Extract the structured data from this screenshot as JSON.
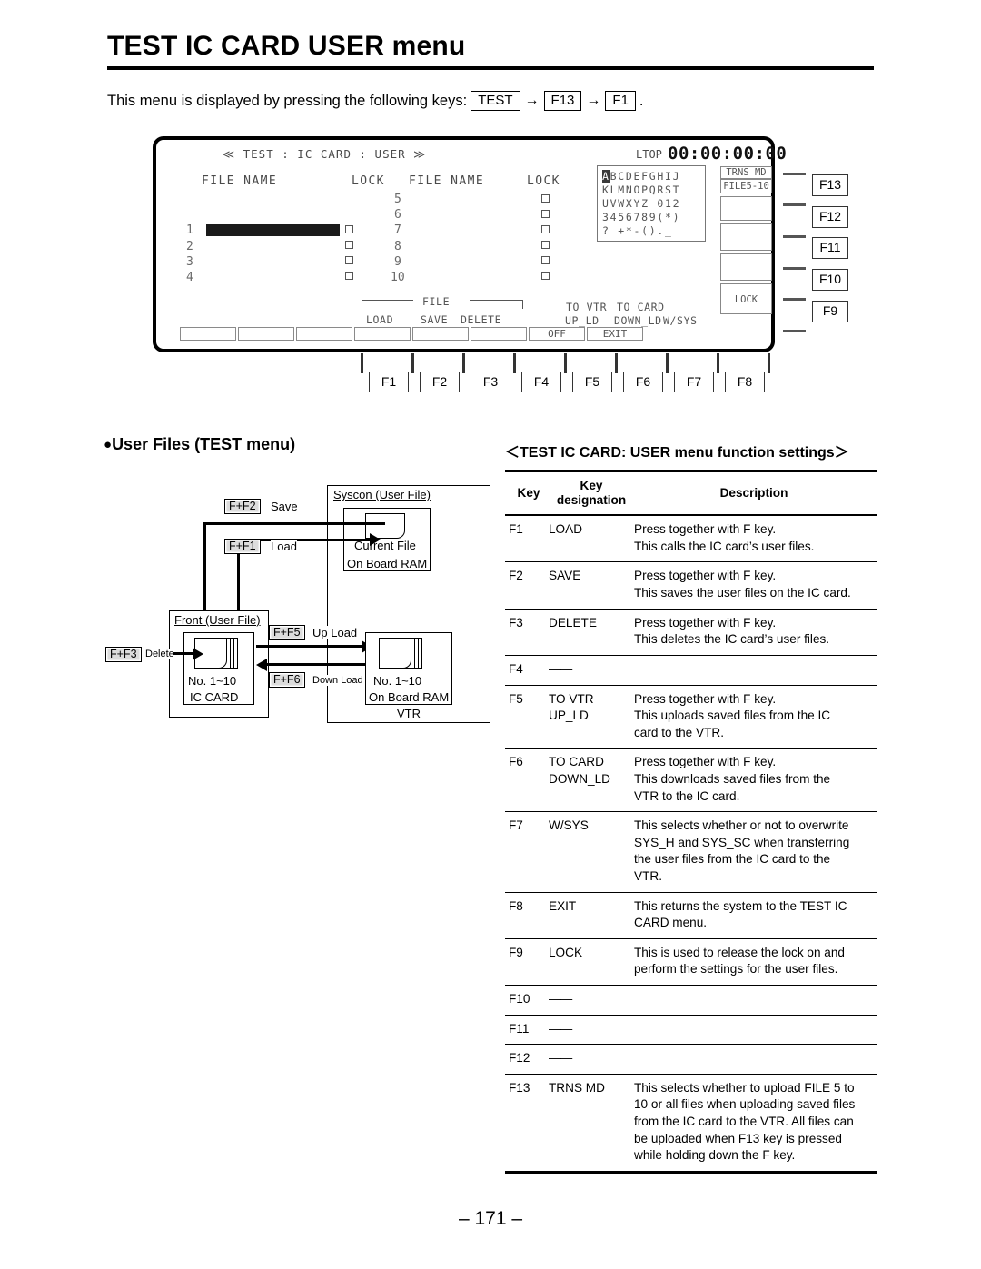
{
  "document": {
    "title": "TEST IC CARD USER menu",
    "intro_prefix": "This menu is displayed by pressing the following keys:",
    "intro_keys": [
      "TEST",
      "F13",
      "F1"
    ],
    "intro_suffix": ".",
    "arrow": "→",
    "page_number": "– 171 –"
  },
  "lcd": {
    "breadcrumb": "≪ TEST : IC CARD : USER ≫",
    "ltop_label": "LTOP",
    "timecode": "00:00:00:00",
    "column_headers": {
      "filename_left": "FILE NAME",
      "lock_left": "LOCK",
      "filename_right": "FILE NAME",
      "lock_right": "LOCK"
    },
    "file_rows_left": [
      "1",
      "2",
      "3",
      "4"
    ],
    "file_rows_right": [
      "5",
      "6",
      "7",
      "8",
      "9",
      "10"
    ],
    "selected_row": "1",
    "char_grid": {
      "highlight": "A",
      "rows": [
        "BCDEFGHIJ",
        "KLMNOPQRST",
        "UVWXYZ 012",
        "3456789(*)",
        "? +*-()._"
      ]
    },
    "right_cells": {
      "trns_md": "TRNS MD",
      "file_range": "FILE5-10",
      "blank1": "",
      "blank2": "",
      "blank3": "",
      "lock": "LOCK"
    },
    "file_group_label": "FILE",
    "soft_labels": {
      "load": "LOAD",
      "save": "SAVE",
      "delete": "DELETE",
      "to_vtr": "TO VTR",
      "up_ld": "UP_LD",
      "to_card": "TO CARD",
      "down_ld": "DOWN_LD",
      "w_sys": "W/SYS"
    },
    "soft_key_values": [
      "",
      "",
      "",
      "",
      "",
      "",
      "OFF",
      "EXIT"
    ]
  },
  "fkeys_right": [
    "F13",
    "F12",
    "F11",
    "F10",
    "F9"
  ],
  "fkeys_bottom": [
    "F1",
    "F2",
    "F3",
    "F4",
    "F5",
    "F6",
    "F7",
    "F8"
  ],
  "userfiles": {
    "heading": "User Files (TEST menu)",
    "bullet": "●",
    "syscon_box": "Syscon (User File)",
    "current_file": "Current File",
    "on_board_ram_top": "On Board RAM",
    "front_box": "Front (User File)",
    "ic_card": "IC CARD",
    "no_range_left": "No. 1~10",
    "no_range_right": "No. 1~10",
    "on_board_ram_bottom": "On Board RAM",
    "vtr": "VTR",
    "tags": {
      "save_key": "F+F2",
      "save_text": "Save",
      "load_key": "F+F1",
      "load_text": "Load",
      "delete_key": "F+F3",
      "delete_text": "Delete",
      "upload_key": "F+F5",
      "upload_text": "Up Load",
      "download_key": "F+F6",
      "download_text": "Down Load"
    }
  },
  "table": {
    "heading": "＜TEST IC CARD: USER menu function settings＞",
    "headers": [
      "Key",
      "Key\ndesignation",
      "Description"
    ],
    "header_key": "Key",
    "header_designation_line1": "Key",
    "header_designation_line2": "designation",
    "header_description": "Description",
    "rows": [
      {
        "key": "F1",
        "designation": "LOAD",
        "description": "Press together with F key.\nThis calls the IC card’s user files."
      },
      {
        "key": "F2",
        "designation": "SAVE",
        "description": "Press together with F key.\nThis saves the user files on the IC card."
      },
      {
        "key": "F3",
        "designation": "DELETE",
        "description": "Press together with F key.\nThis deletes the IC card’s user files."
      },
      {
        "key": "F4",
        "designation": "——",
        "description": ""
      },
      {
        "key": "F5",
        "designation": "TO VTR\nUP_LD",
        "description": "Press together with F key.\nThis uploads saved files from the IC\ncard to the VTR."
      },
      {
        "key": "F6",
        "designation": "TO CARD\nDOWN_LD",
        "description": "Press together with F key.\nThis downloads saved files from the\nVTR to the IC card."
      },
      {
        "key": "F7",
        "designation": "W/SYS",
        "description": "This selects whether or not to overwrite\nSYS_H and SYS_SC when transferring\nthe user files from the IC card to the\nVTR."
      },
      {
        "key": "F8",
        "designation": "EXIT",
        "description": "This returns the system to the TEST IC\nCARD menu."
      },
      {
        "key": "F9",
        "designation": "LOCK",
        "description": "This is used to release the lock on and\nperform the settings for the user files."
      },
      {
        "key": "F10",
        "designation": "——",
        "description": ""
      },
      {
        "key": "F11",
        "designation": "——",
        "description": ""
      },
      {
        "key": "F12",
        "designation": "——",
        "description": ""
      },
      {
        "key": "F13",
        "designation": "TRNS MD",
        "description": "This selects whether to upload FILE 5 to\n10 or all files when uploading saved files\nfrom the IC card to the VTR. All files can\nbe uploaded when F13 key is pressed\nwhile holding down the F key."
      }
    ]
  }
}
